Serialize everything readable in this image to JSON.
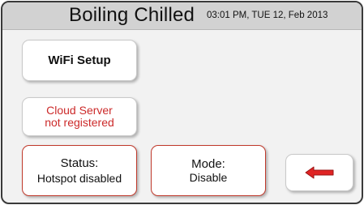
{
  "header": {
    "title": "Boiling Chilled",
    "datetime": "03:01 PM, TUE 12, Feb 2013"
  },
  "buttons": {
    "wifi_setup": "WiFi Setup",
    "cloud_line1": "Cloud Server",
    "cloud_line2": "not registered",
    "status_line1": "Status:",
    "status_line2": "Hotspot disabled",
    "mode_line1": "Mode:",
    "mode_line2": "Disable",
    "back_icon": "left-arrow-icon"
  },
  "colors": {
    "header_bg": "#d2d2d2",
    "screen_bg": "#f2f2f2",
    "alert_red": "#cc2a2a",
    "button_border_red": "#c0392b",
    "arrow_fill": "#e02424"
  }
}
